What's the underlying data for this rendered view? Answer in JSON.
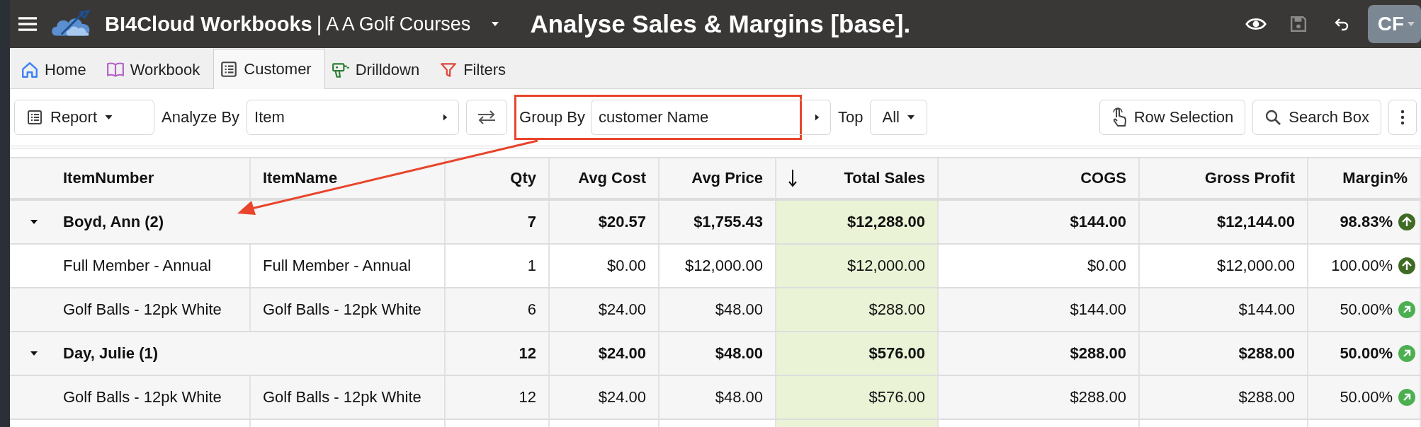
{
  "header": {
    "app_name": "BI4Cloud Workbooks",
    "separator": "|",
    "company": "A A Golf Courses",
    "report_title": "Analyse Sales & Margins [base].",
    "avatar": "CF"
  },
  "tabs": [
    {
      "label": "Home",
      "selected": false
    },
    {
      "label": "Workbook",
      "selected": false
    },
    {
      "label": "Customer",
      "selected": true
    },
    {
      "label": "Drilldown",
      "selected": false
    },
    {
      "label": "Filters",
      "selected": false
    }
  ],
  "toolbar": {
    "report_button": "Report",
    "analyze_by_label": "Analyze By",
    "analyze_by_value": "Item",
    "group_by_label": "Group By",
    "group_by_value": "customer Name",
    "top_label": "Top",
    "top_value": "All",
    "row_selection_button": "Row Selection",
    "search_box_button": "Search Box"
  },
  "table": {
    "columns": [
      {
        "label": "ItemNumber",
        "sorted": false
      },
      {
        "label": "ItemName",
        "sorted": false
      },
      {
        "label": "Qty",
        "sorted": false
      },
      {
        "label": "Avg Cost",
        "sorted": false
      },
      {
        "label": "Avg Price",
        "sorted": false
      },
      {
        "label": "Total Sales",
        "sorted": true
      },
      {
        "label": "COGS",
        "sorted": false
      },
      {
        "label": "Gross Profit",
        "sorted": false
      },
      {
        "label": "Margin%",
        "sorted": false
      }
    ],
    "rows": [
      {
        "kind": "group",
        "expanded": true,
        "cells": [
          "Boyd, Ann (2)",
          "7",
          "$20.57",
          "$1,755.43",
          "$12,288.00",
          "$144.00",
          "$12,144.00",
          "98.83%"
        ],
        "arrow_up": true
      },
      {
        "kind": "item",
        "cells": [
          "Full Member - Annual",
          "Full Member - Annual",
          "1",
          "$0.00",
          "$12,000.00",
          "$12,000.00",
          "$0.00",
          "$12,000.00",
          "100.00%"
        ],
        "arrow_up": true
      },
      {
        "kind": "item",
        "cells": [
          "Golf Balls - 12pk White",
          "Golf Balls - 12pk White",
          "6",
          "$24.00",
          "$48.00",
          "$288.00",
          "$144.00",
          "$144.00",
          "50.00%"
        ],
        "arrow_up": false
      },
      {
        "kind": "group",
        "expanded": true,
        "cells": [
          "Day, Julie (1)",
          "12",
          "$24.00",
          "$48.00",
          "$576.00",
          "$288.00",
          "$288.00",
          "50.00%"
        ],
        "arrow_up": false
      },
      {
        "kind": "item",
        "cells": [
          "Golf Balls - 12pk White",
          "Golf Balls - 12pk White",
          "12",
          "$24.00",
          "$48.00",
          "$576.00",
          "$288.00",
          "$288.00",
          "50.00%"
        ],
        "arrow_up": false
      }
    ]
  }
}
